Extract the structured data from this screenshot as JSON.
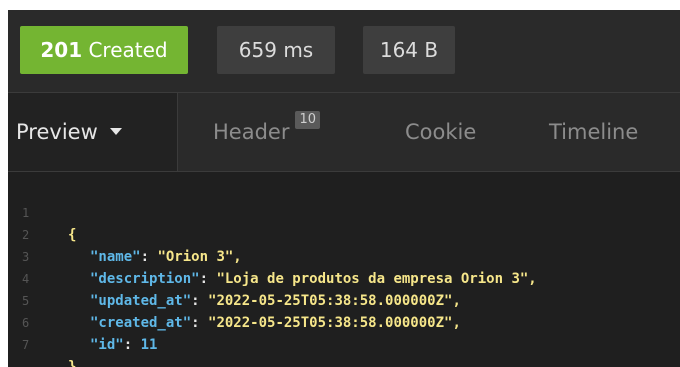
{
  "response": {
    "status_code": "201",
    "status_text": "Created",
    "time": "659 ms",
    "size": "164 B",
    "status_color": "#74b532"
  },
  "tabs": {
    "preview": "Preview",
    "header": "Header",
    "header_count": "10",
    "cookie": "Cookie",
    "timeline": "Timeline"
  },
  "json": {
    "line_numbers": [
      "1",
      "2",
      "3",
      "4",
      "5",
      "6",
      "7"
    ],
    "open_brace": "{",
    "close_brace": "}",
    "fields": [
      {
        "key": "\"name\"",
        "value": "\"Orion 3\","
      },
      {
        "key": "\"description\"",
        "value": "\"Loja de produtos da empresa Orion 3\","
      },
      {
        "key": "\"updated_at\"",
        "value": "\"2022-05-25T05:38:58.000000Z\","
      },
      {
        "key": "\"created_at\"",
        "value": "\"2022-05-25T05:38:58.000000Z\","
      },
      {
        "key": "\"id\"",
        "value": "11"
      }
    ]
  }
}
